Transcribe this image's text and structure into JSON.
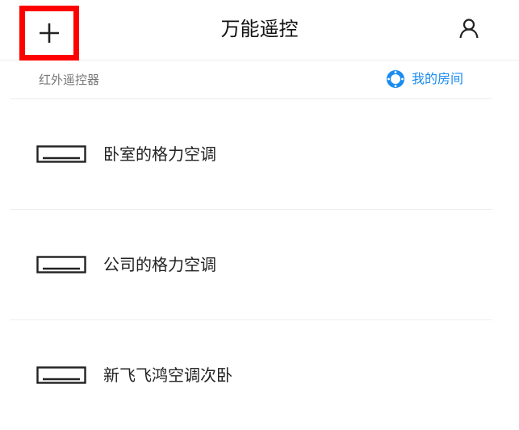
{
  "header": {
    "title": "万能遥控",
    "add_icon": "plus-icon",
    "profile_icon": "user-icon"
  },
  "subbar": {
    "section_label": "红外遥控器",
    "my_room_label": "我的房间",
    "my_room_icon": "ring-icon",
    "accent_color": "#1a8cf0"
  },
  "devices": [
    {
      "label": "卧室的格力空调",
      "icon": "air-conditioner-icon"
    },
    {
      "label": "公司的格力空调",
      "icon": "air-conditioner-icon"
    },
    {
      "label": "新飞飞鸿空调次卧",
      "icon": "air-conditioner-icon"
    }
  ],
  "highlight_color": "#ff0000"
}
